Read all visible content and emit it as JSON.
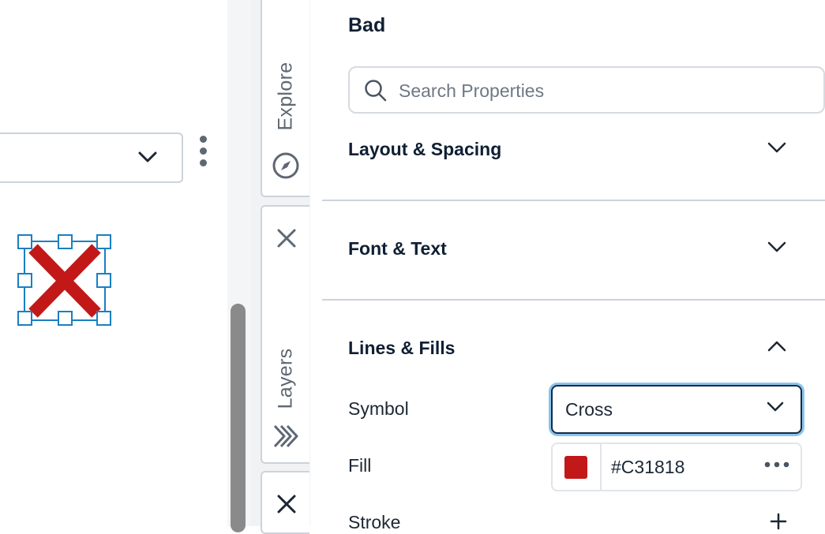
{
  "canvas": {
    "selected_symbol": "cross",
    "symbol_color": "#C31818",
    "handle_color": "#1a7fc1"
  },
  "tabs": {
    "explore_label": "Explore",
    "layers_label": "Layers"
  },
  "panel": {
    "title": "Bad",
    "search_placeholder": "Search Properties",
    "sections": {
      "layout": "Layout & Spacing",
      "font": "Font & Text",
      "lines": "Lines & Fills"
    },
    "properties": {
      "symbol_label": "Symbol",
      "symbol_value": "Cross",
      "fill_label": "Fill",
      "fill_value": "#C31818",
      "stroke_label": "Stroke"
    }
  },
  "colors": {
    "heading": "#0f1f33",
    "divider": "#cdd3da",
    "focus_ring": "#8ec3ea"
  }
}
